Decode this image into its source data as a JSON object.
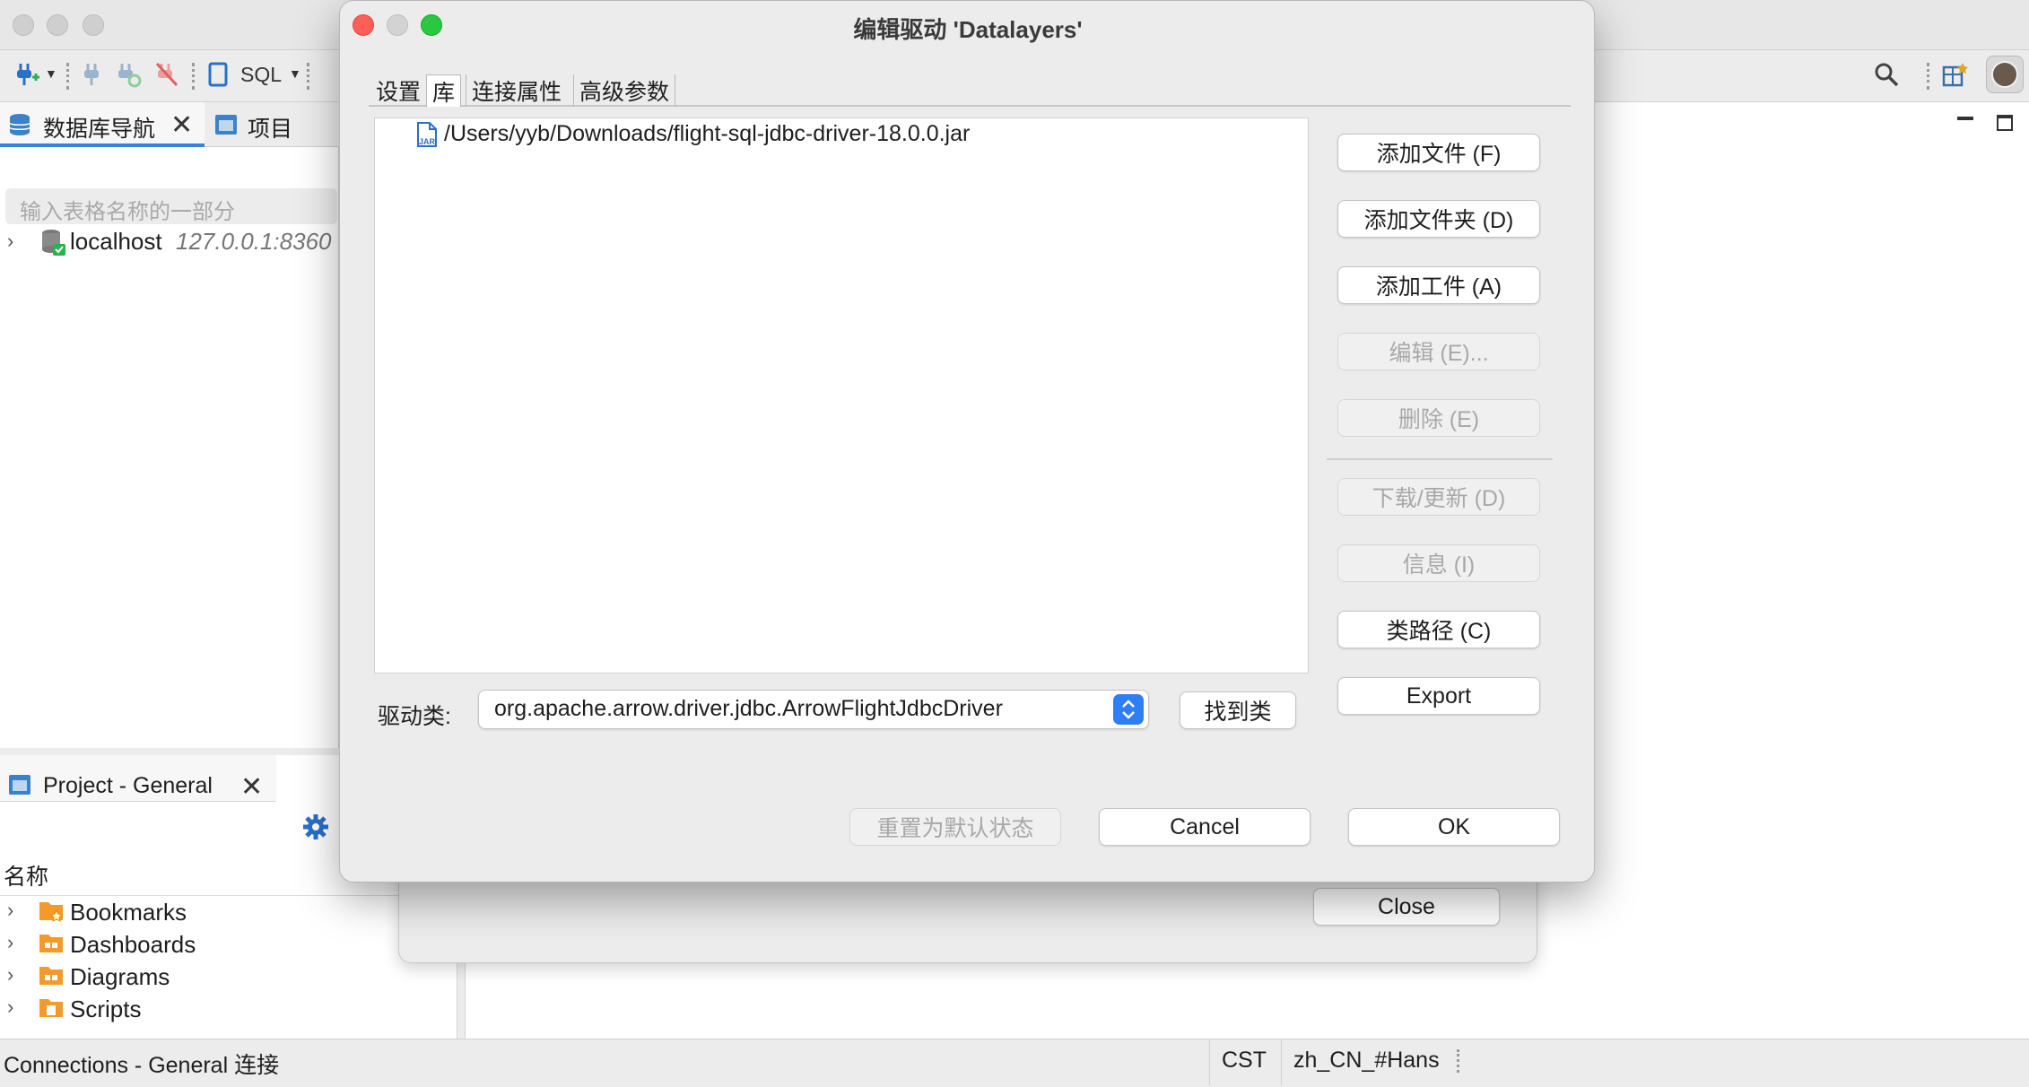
{
  "app": {
    "toolbar": {
      "sql_label": "SQL"
    },
    "nav_tabs": [
      {
        "label": "数据库导航"
      },
      {
        "label": "项目"
      }
    ],
    "filter_placeholder": "输入表格名称的一部分",
    "connection": {
      "name": "localhost",
      "address": "127.0.0.1:8360"
    },
    "project_panel": {
      "tab_label": "Project - General",
      "column_header": "名称",
      "items": [
        {
          "label": "Bookmarks",
          "icon": "bookmarks-folder-icon"
        },
        {
          "label": "Dashboards",
          "icon": "dashboards-folder-icon"
        },
        {
          "label": "Diagrams",
          "icon": "diagrams-folder-icon"
        },
        {
          "label": "Scripts",
          "icon": "scripts-folder-icon"
        }
      ]
    },
    "status_bar": {
      "left": "Connections - General 连接",
      "timezone": "CST",
      "locale": "zh_CN_#Hans"
    }
  },
  "background_dialog": {
    "close_label": "Close"
  },
  "dialog": {
    "title": "编辑驱动 'Datalayers'",
    "tabs": [
      {
        "label": "设置",
        "selected": false
      },
      {
        "label": "库",
        "selected": true
      },
      {
        "label": "连接属性",
        "selected": false
      },
      {
        "label": "高级参数",
        "selected": false
      }
    ],
    "library_files": [
      {
        "path": "/Users/yyb/Downloads/flight-sql-jdbc-driver-18.0.0.jar",
        "icon": "jar-file-icon"
      }
    ],
    "side_buttons": [
      {
        "label": "添加文件 (F)",
        "enabled": true
      },
      {
        "label": "添加文件夹 (D)",
        "enabled": true
      },
      {
        "label": "添加工件 (A)",
        "enabled": true
      },
      {
        "label": "编辑 (E)...",
        "enabled": false
      },
      {
        "label": "删除 (E)",
        "enabled": false
      },
      {
        "label": "下载/更新 (D)",
        "enabled": false
      },
      {
        "label": "信息 (I)",
        "enabled": false
      },
      {
        "label": "类路径 (C)",
        "enabled": true
      },
      {
        "label": "Export",
        "enabled": true
      }
    ],
    "driver_class_label": "驱动类:",
    "driver_class_value": "org.apache.arrow.driver.jdbc.ArrowFlightJdbcDriver",
    "find_class_label": "找到类",
    "reset_label": "重置为默认状态",
    "cancel_label": "Cancel",
    "ok_label": "OK"
  },
  "colors": {
    "accent": "#2f7ef6",
    "close_red": "#ff5f57",
    "minimize_gray": "#cfcfcf",
    "zoom_green": "#28c840"
  }
}
